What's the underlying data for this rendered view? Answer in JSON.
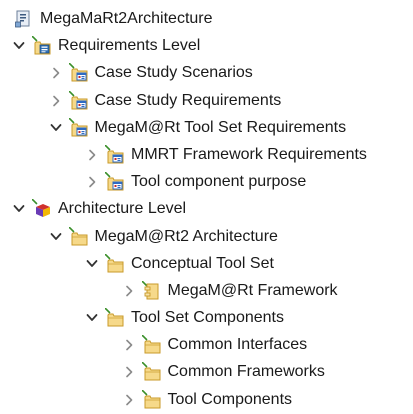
{
  "tree": {
    "nodes": [
      {
        "label": "MegaMaRt2Architecture",
        "depth": 0,
        "toggle": "none",
        "icon": "model-icon",
        "marker": false
      },
      {
        "label": "Requirements Level",
        "depth": 0,
        "toggle": "expanded",
        "icon": "package-requirements-icon",
        "marker": true
      },
      {
        "label": "Case Study Scenarios",
        "depth": 1,
        "toggle": "collapsed",
        "icon": "requirement-package-icon",
        "marker": true
      },
      {
        "label": "Case Study Requirements",
        "depth": 1,
        "toggle": "collapsed",
        "icon": "requirement-package-icon",
        "marker": true
      },
      {
        "label": "MegaM@Rt Tool Set Requirements",
        "depth": 1,
        "toggle": "expanded",
        "icon": "requirement-package-icon",
        "marker": true
      },
      {
        "label": "MMRT Framework Requirements",
        "depth": 2,
        "toggle": "collapsed",
        "icon": "requirement-package-icon",
        "marker": true
      },
      {
        "label": "Tool component purpose",
        "depth": 2,
        "toggle": "collapsed",
        "icon": "requirement-package-icon",
        "marker": true
      },
      {
        "label": "Architecture Level",
        "depth": 0,
        "toggle": "expanded",
        "icon": "architecture-level-icon",
        "marker": true
      },
      {
        "label": "MegaM@Rt2 Architecture",
        "depth": 1,
        "toggle": "expanded",
        "icon": "folder-icon",
        "marker": true
      },
      {
        "label": "Conceptual Tool Set",
        "depth": 2,
        "toggle": "expanded",
        "icon": "folder-icon",
        "marker": true
      },
      {
        "label": "MegaM@Rt Framework",
        "depth": 3,
        "toggle": "collapsed",
        "icon": "component-icon",
        "marker": true
      },
      {
        "label": "Tool Set Components",
        "depth": 2,
        "toggle": "expanded",
        "icon": "folder-icon",
        "marker": true
      },
      {
        "label": "Common Interfaces",
        "depth": 3,
        "toggle": "collapsed",
        "icon": "folder-icon",
        "marker": true
      },
      {
        "label": "Common Frameworks",
        "depth": 3,
        "toggle": "collapsed",
        "icon": "folder-icon",
        "marker": true
      },
      {
        "label": "Tool Components",
        "depth": 3,
        "toggle": "collapsed",
        "icon": "folder-icon",
        "marker": true
      }
    ]
  },
  "colors": {
    "text": "#1a1a1a",
    "twisty_expanded": "#333333",
    "twisty_collapsed": "#8a8a8a",
    "folder_fill": "#f6d98a",
    "folder_stroke": "#c89a2a",
    "marker_green": "#3a8f2a",
    "requirement_blue": "#2e6bc4",
    "requirement_red": "#c62828",
    "arch_red": "#d0312d",
    "arch_purple": "#6a3bb5",
    "arch_yellow": "#f2b705"
  }
}
